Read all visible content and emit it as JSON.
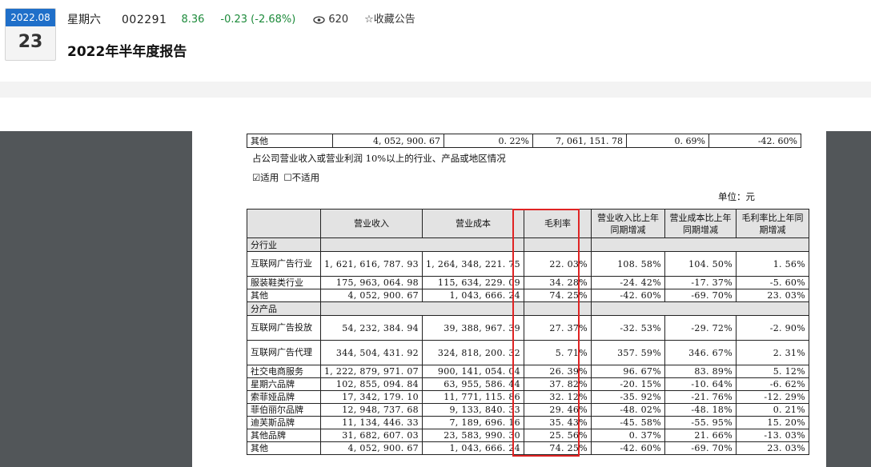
{
  "header": {
    "date_month": "2022.08",
    "date_day": "23",
    "stock_name": "星期六",
    "stock_code": "002291",
    "price": "8.36",
    "change": "-0.23 (-2.68%)",
    "views": "620",
    "views_icon": "eye-icon",
    "favorite_label": "☆收藏公告",
    "report_title": "2022年半年度报告",
    "colors": {
      "badge_blue": "#1f6fc9",
      "down_green": "#1c8a3a",
      "highlight_red": "#e02424"
    }
  },
  "document": {
    "top_row": {
      "label": "其他",
      "c1": "4, 052, 900. 67",
      "c2": "0. 22%",
      "c3": "7, 061, 151. 78",
      "c4": "0. 69%",
      "c5": "-42. 60%"
    },
    "note": "占公司营业收入或营业利润 10%以上的行业、产品或地区情况",
    "applicable": "☑适用",
    "not_applicable": "☐不适用",
    "unit": "单位：元",
    "headers": [
      "",
      "营业收入",
      "营业成本",
      "毛利率",
      "营业收入比上年同期增减",
      "营业成本比上年同期增减",
      "毛利率比上年同期增减"
    ],
    "sections": [
      {
        "title": "分行业",
        "rows": [
          {
            "label": "互联网广告行业",
            "revenue": "1, 621, 616, 787. 93",
            "cost": "1, 264, 348, 221. 75",
            "margin": "22. 03%",
            "rev_chg": "108. 58%",
            "cost_chg": "104. 50%",
            "margin_chg": "1. 56%"
          },
          {
            "label": "服装鞋类行业",
            "revenue": "175, 963, 064. 98",
            "cost": "115, 634, 229. 09",
            "margin": "34. 28%",
            "rev_chg": "-24. 42%",
            "cost_chg": "-17. 37%",
            "margin_chg": "-5. 60%"
          },
          {
            "label": "其他",
            "revenue": "4, 052, 900. 67",
            "cost": "1, 043, 666. 24",
            "margin": "74. 25%",
            "rev_chg": "-42. 60%",
            "cost_chg": "-69. 70%",
            "margin_chg": "23. 03%"
          }
        ]
      },
      {
        "title": "分产品",
        "rows": [
          {
            "label": "互联网广告投放",
            "revenue": "54, 232, 384. 94",
            "cost": "39, 388, 967. 39",
            "margin": "27. 37%",
            "rev_chg": "-32. 53%",
            "cost_chg": "-29. 72%",
            "margin_chg": "-2. 90%"
          },
          {
            "label": "互联网广告代理",
            "revenue": "344, 504, 431. 92",
            "cost": "324, 818, 200. 32",
            "margin": "5. 71%",
            "rev_chg": "357. 59%",
            "cost_chg": "346. 67%",
            "margin_chg": "2. 31%"
          },
          {
            "label": "社交电商服务",
            "revenue": "1, 222, 879, 971. 07",
            "cost": "900, 141, 054. 04",
            "margin": "26. 39%",
            "rev_chg": "96. 67%",
            "cost_chg": "83. 89%",
            "margin_chg": "5. 12%"
          },
          {
            "label": "星期六品牌",
            "revenue": "102, 855, 094. 84",
            "cost": "63, 955, 586. 44",
            "margin": "37. 82%",
            "rev_chg": "-20. 15%",
            "cost_chg": "-10. 64%",
            "margin_chg": "-6. 62%"
          },
          {
            "label": "索菲娅品牌",
            "revenue": "17, 342, 179. 10",
            "cost": "11, 771, 115. 86",
            "margin": "32. 12%",
            "rev_chg": "-35. 92%",
            "cost_chg": "-21. 76%",
            "margin_chg": "-12. 29%"
          },
          {
            "label": "菲伯丽尔品牌",
            "revenue": "12, 948, 737. 68",
            "cost": "9, 133, 840. 33",
            "margin": "29. 46%",
            "rev_chg": "-48. 02%",
            "cost_chg": "-48. 18%",
            "margin_chg": "0. 21%"
          },
          {
            "label": "迪芙斯品牌",
            "revenue": "11, 134, 446. 33",
            "cost": "7, 189, 696. 16",
            "margin": "35. 43%",
            "rev_chg": "-45. 58%",
            "cost_chg": "-55. 95%",
            "margin_chg": "15. 20%"
          },
          {
            "label": "其他品牌",
            "revenue": "31, 682, 607. 03",
            "cost": "23, 583, 990. 30",
            "margin": "25. 56%",
            "rev_chg": "0. 37%",
            "cost_chg": "21. 66%",
            "margin_chg": "-13. 03%"
          },
          {
            "label": "其他",
            "revenue": "4, 052, 900. 67",
            "cost": "1, 043, 666. 24",
            "margin": "74. 25%",
            "rev_chg": "-42. 60%",
            "cost_chg": "-69. 70%",
            "margin_chg": "23. 03%"
          }
        ]
      }
    ]
  }
}
